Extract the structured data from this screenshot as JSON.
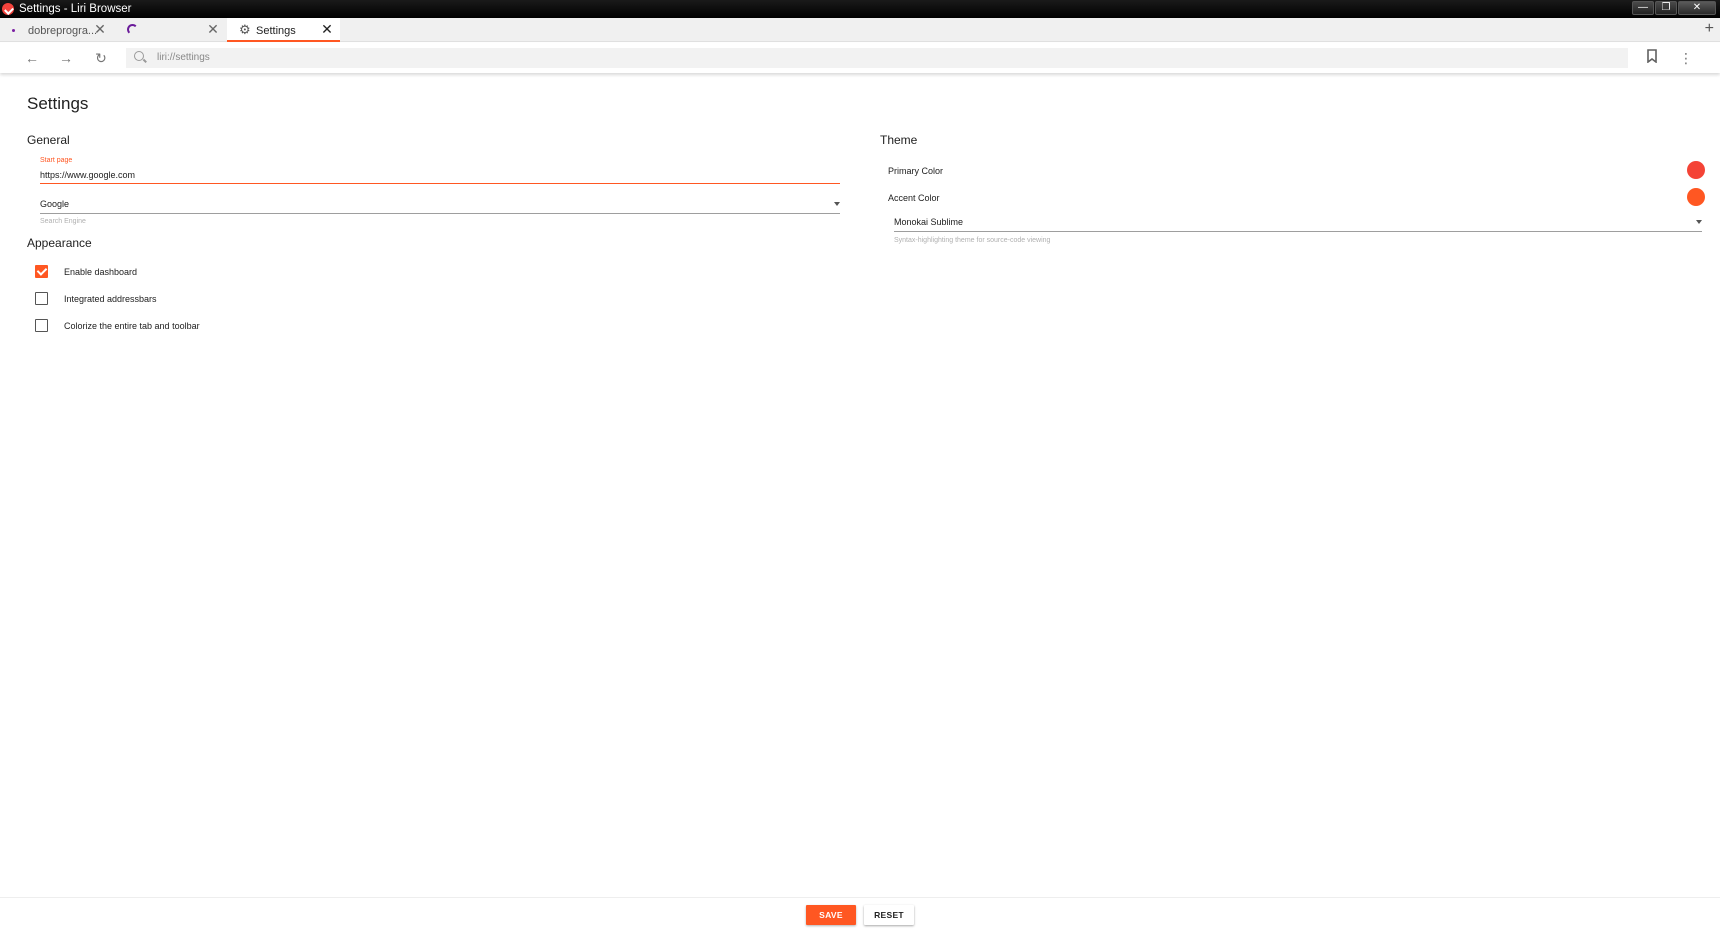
{
  "window": {
    "title": "Settings - Liri Browser",
    "controls": {
      "minimize": "—",
      "maximize": "❐",
      "close": "✕"
    }
  },
  "tabs": [
    {
      "label": "dobreprogra...",
      "icon": "favicon-dot",
      "active": false
    },
    {
      "label": "",
      "icon": "loading-spinner",
      "active": false
    },
    {
      "label": "Settings",
      "icon": "gear-icon",
      "active": true
    }
  ],
  "tab_close_glyph": "✕",
  "new_tab_glyph": "+",
  "toolbar": {
    "back_glyph": "←",
    "forward_glyph": "→",
    "reload_glyph": "↻",
    "url": "liri://settings",
    "bookmark_glyph": "🔖",
    "menu_glyph": "⋮"
  },
  "page": {
    "title": "Settings"
  },
  "general": {
    "title": "General",
    "start_page_label": "Start page",
    "start_page_value": "https://www.google.com",
    "search_engine_value": "Google",
    "search_engine_helper": "Search Engine"
  },
  "appearance": {
    "title": "Appearance",
    "options": [
      {
        "label": "Enable dashboard",
        "checked": true
      },
      {
        "label": "Integrated addressbars",
        "checked": false
      },
      {
        "label": "Colorize the entire tab and toolbar",
        "checked": false
      }
    ]
  },
  "theme": {
    "title": "Theme",
    "primary_label": "Primary Color",
    "primary_color": "#f44336",
    "accent_label": "Accent Color",
    "accent_color": "#ff5722",
    "syntax_theme_value": "Monokai Sublime",
    "syntax_theme_helper": "Syntax-highlighting theme for source-code viewing"
  },
  "footer": {
    "save_label": "SAVE",
    "reset_label": "RESET"
  }
}
